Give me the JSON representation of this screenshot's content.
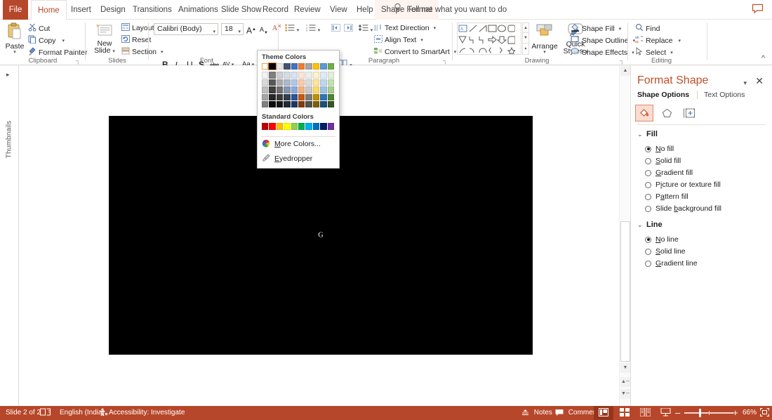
{
  "window": {
    "app": "PowerPoint"
  },
  "tabs": [
    {
      "label": "File",
      "name": "tab-file"
    },
    {
      "label": "Home",
      "name": "tab-home"
    },
    {
      "label": "Insert",
      "name": "tab-insert"
    },
    {
      "label": "Design",
      "name": "tab-design"
    },
    {
      "label": "Transitions",
      "name": "tab-transitions"
    },
    {
      "label": "Animations",
      "name": "tab-animations"
    },
    {
      "label": "Slide Show",
      "name": "tab-slide-show"
    },
    {
      "label": "Record",
      "name": "tab-record"
    },
    {
      "label": "Review",
      "name": "tab-review"
    },
    {
      "label": "View",
      "name": "tab-view"
    },
    {
      "label": "Help",
      "name": "tab-help"
    },
    {
      "label": "Shape Format",
      "name": "tab-shape-format"
    }
  ],
  "tellme": {
    "placeholder": "Tell me what you want to do",
    "icon": "lightbulb-icon"
  },
  "ribbon": {
    "clipboard": {
      "label": "Clipboard",
      "paste": "Paste",
      "cut": "Cut",
      "copy": "Copy",
      "format_painter": "Format Painter"
    },
    "slides": {
      "label": "Slides",
      "new_slide": "New\nSlide",
      "new_slide_l1": "New",
      "new_slide_l2": "Slide",
      "layout": "Layout",
      "reset": "Reset",
      "section": "Section"
    },
    "font": {
      "label": "Font",
      "font_name": "Calibri (Body)",
      "font_size": "18",
      "grow": "A",
      "shrink": "A",
      "clear_formatting": "clear-formatting-icon",
      "bold": "B",
      "italic": "I",
      "underline": "U",
      "shadow": "S",
      "strikethrough": "abc",
      "character_spacing": "AV",
      "change_case": "Aa",
      "font_color": "A"
    },
    "paragraph": {
      "label": "Paragraph",
      "text_direction": "Text Direction",
      "align_text": "Align Text",
      "convert_to_smartart": "Convert to SmartArt"
    },
    "drawing": {
      "label": "Drawing",
      "arrange": "Arrange",
      "quick_styles_l1": "Quick",
      "quick_styles_l2": "Styles",
      "shape_fill": "Shape Fill",
      "shape_outline": "Shape Outline",
      "shape_effects": "Shape Effects"
    },
    "editing": {
      "label": "Editing",
      "find": "Find",
      "replace": "Replace",
      "select": "Select"
    },
    "collapse_ribbon": "collapse-ribbon-icon"
  },
  "color_menu": {
    "theme_header": "Theme Colors",
    "standard_header": "Standard Colors",
    "more_colors": "More Colors...",
    "eyedropper": "Eyedropper",
    "theme_base": [
      "#FFFFFF",
      "#000000",
      "#E7E6E6",
      "#44546A",
      "#4472C4",
      "#ED7D31",
      "#A5A5A5",
      "#FFC000",
      "#5B9BD5",
      "#70AD47"
    ],
    "theme_rows": [
      [
        "#F2F2F2",
        "#7F7F7F",
        "#D0CECE",
        "#D6DCE4",
        "#D9E2F3",
        "#FBE5D5",
        "#EDEDED",
        "#FFF2CC",
        "#DEEBF6",
        "#E2EFD9"
      ],
      [
        "#D9D9D9",
        "#595959",
        "#AEAAAA",
        "#ACB9CA",
        "#B4C6E7",
        "#F7CBAC",
        "#DBDBDB",
        "#FFE599",
        "#BDD7EE",
        "#C5E0B3"
      ],
      [
        "#BFBFBF",
        "#3F3F3F",
        "#757070",
        "#8496B0",
        "#8EAADB",
        "#F4B183",
        "#C9C9C9",
        "#FFD966",
        "#9CC3E5",
        "#A8D08D"
      ],
      [
        "#A6A6A6",
        "#262626",
        "#3A3838",
        "#323F4F",
        "#2F5496",
        "#C55A11",
        "#7B7B7B",
        "#BF8F00",
        "#2E75B5",
        "#538135"
      ],
      [
        "#808080",
        "#0C0C0C",
        "#171616",
        "#222A35",
        "#1F3863",
        "#833C0B",
        "#525252",
        "#7F6000",
        "#1E4E79",
        "#375623"
      ]
    ],
    "standard_colors": [
      "#C00000",
      "#FF0000",
      "#FFC000",
      "#FFFF00",
      "#92D050",
      "#00B050",
      "#00B0F0",
      "#0070C0",
      "#002060",
      "#7030A0"
    ],
    "selected_swatch": "#000000"
  },
  "thumbnails_rail": {
    "label": "Thumbnails",
    "expand_icon": "chevron-right-icon"
  },
  "slide": {
    "text": "G",
    "background": "#000000"
  },
  "pane": {
    "title": "Format Shape",
    "dropdown_icon": "chevron-down-icon",
    "close_icon": "close-icon",
    "tab_shape_options": "Shape Options",
    "tab_text_options": "Text Options",
    "icon_tabs": [
      "fill-bucket-icon",
      "pentagon-effects-icon",
      "size-properties-icon"
    ],
    "fill": {
      "header": "Fill",
      "options": [
        {
          "label": "No fill",
          "u": "N",
          "rest": "o fill",
          "selected": true
        },
        {
          "label": "Solid fill",
          "u": "S",
          "rest": "olid fill",
          "selected": false
        },
        {
          "label": "Gradient fill",
          "u": "G",
          "rest": "radient fill",
          "selected": false
        },
        {
          "label": "Picture or texture fill",
          "pre": "P",
          "u": "i",
          "rest": "cture or texture fill",
          "selected": false
        },
        {
          "label": "Pattern fill",
          "pre": "P",
          "u": "a",
          "rest": "ttern fill",
          "selected": false
        },
        {
          "label": "Slide background fill",
          "pre": "Slide ",
          "u": "b",
          "rest": "ackground fill",
          "selected": false
        }
      ]
    },
    "line": {
      "header": "Line",
      "options": [
        {
          "label": "No line",
          "u": "N",
          "rest": "o line",
          "selected": true
        },
        {
          "label": "Solid line",
          "u": "S",
          "rest": "olid line",
          "selected": false
        },
        {
          "label": "Gradient line",
          "u": "G",
          "rest": "radient line",
          "selected": false
        }
      ]
    }
  },
  "status": {
    "slide_counter": "Slide 2 of 2",
    "language": "English (India)",
    "accessibility": "Accessibility: Investigate",
    "notes": "Notes",
    "comments": "Comments",
    "zoom_level": "66%",
    "zoom_out": "–",
    "zoom_in": "+",
    "views": [
      "normal-view-icon",
      "slide-sorter-icon",
      "reading-view-icon",
      "slide-show-icon"
    ],
    "fit_slide_icon": "fit-slide-to-window-icon"
  },
  "colors": {
    "accent": "#b7472a",
    "status_bar": "#b7472a",
    "pane_title": "#c0502a",
    "selection": "#fbdcd0"
  }
}
